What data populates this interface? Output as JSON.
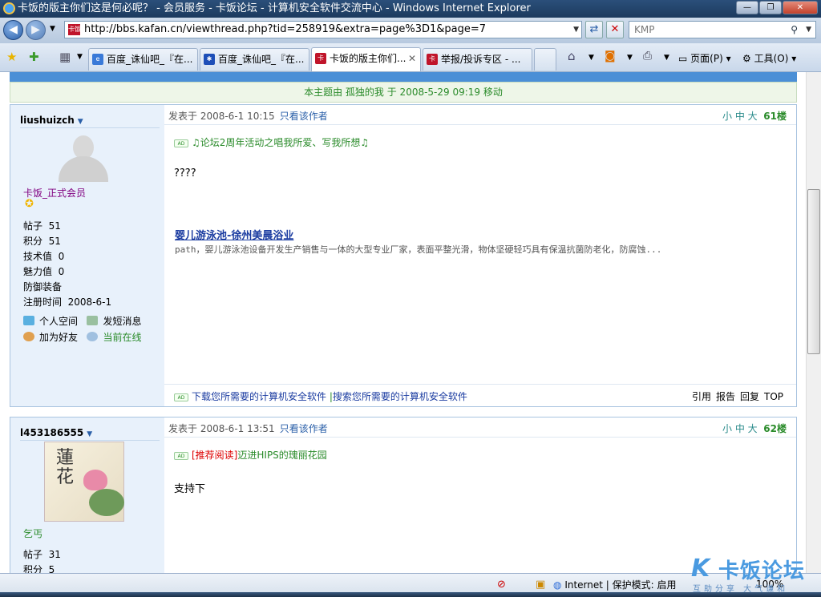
{
  "window": {
    "title": "卡饭的版主你们这是何必呢？ - 会员服务 - 卡饭论坛 - 计算机安全软件交流中心 - Windows Internet Explorer",
    "minimize": "—",
    "restore": "❐",
    "close": "✕"
  },
  "nav": {
    "url": "http://bbs.kafan.cn/viewthread.php?tid=258919&extra=page%3D1&page=7",
    "favicon_text": "卡饭",
    "search_text": "KMP"
  },
  "tabs": [
    {
      "label": "百度_诛仙吧_『在..."
    },
    {
      "label": "百度_诛仙吧_『在..."
    },
    {
      "label": "卡饭的版主你们..."
    },
    {
      "label": "举报/投诉专区 - ..."
    }
  ],
  "commands": {
    "page": "页面(P)",
    "tools": "工具(O)"
  },
  "thread": {
    "move_note": "本主题由  孤独的我  于  2008-5-29 09:19 移动"
  },
  "posts": [
    {
      "username": "liushuizch",
      "rank": "卡饭_正式会员",
      "stats": [
        {
          "k": "帖子",
          "v": "51"
        },
        {
          "k": "积分",
          "v": "51"
        },
        {
          "k": "技术值",
          "v": "0"
        },
        {
          "k": "魅力值",
          "v": "0"
        },
        {
          "k": "防御装备",
          "v": ""
        },
        {
          "k": "注册时间",
          "v": "2008-6-1"
        }
      ],
      "links": {
        "space": "个人空间",
        "pm": "发短消息",
        "friend": "加为好友",
        "online": "当前在线"
      },
      "date": "发表于  2008-6-1 10:15",
      "only_author": "只看该作者",
      "fontsize": "小 中 大",
      "floor": "61楼",
      "ad_text": "♫论坛2周年活动之唱我所爱、写我所想♫",
      "body": "????",
      "promo_title": "婴儿游泳池-徐州美晨浴业",
      "promo_desc": "path，婴儿游泳池设备开发生产销售与一体的大型专业厂家，表面平整光滑，物体坚硬轻巧具有保温抗菌防老化，防腐蚀...",
      "foot_left_1": "下载您所需要的计算机安全软件",
      "foot_sep": "|",
      "foot_left_2": "搜索您所需要的计算机安全软件",
      "actions": [
        "引用",
        "报告",
        "回复",
        "TOP"
      ]
    },
    {
      "username": "l453186555",
      "avatar_char": "蓮花",
      "rank": "乞丐",
      "stats": [
        {
          "k": "帖子",
          "v": "31"
        },
        {
          "k": "积分",
          "v": "5"
        }
      ],
      "date": "发表于  2008-6-1 13:51",
      "only_author": "只看该作者",
      "fontsize": "小 中 大",
      "floor": "62楼",
      "ad_red": "[推荐阅读]",
      "ad_text": "迈进HIPS的瑰丽花园",
      "body": "支持下"
    }
  ],
  "status": {
    "zone": "Internet | 保护模式: 启用",
    "zoom": "100%"
  },
  "logo": {
    "mark": "K",
    "text": "卡饭论坛",
    "slogan": "互助分享  大气谦和"
  },
  "colors": {
    "accent": "#4b8fd6",
    "green": "#2a8b2a",
    "link": "#1a3ba0"
  }
}
